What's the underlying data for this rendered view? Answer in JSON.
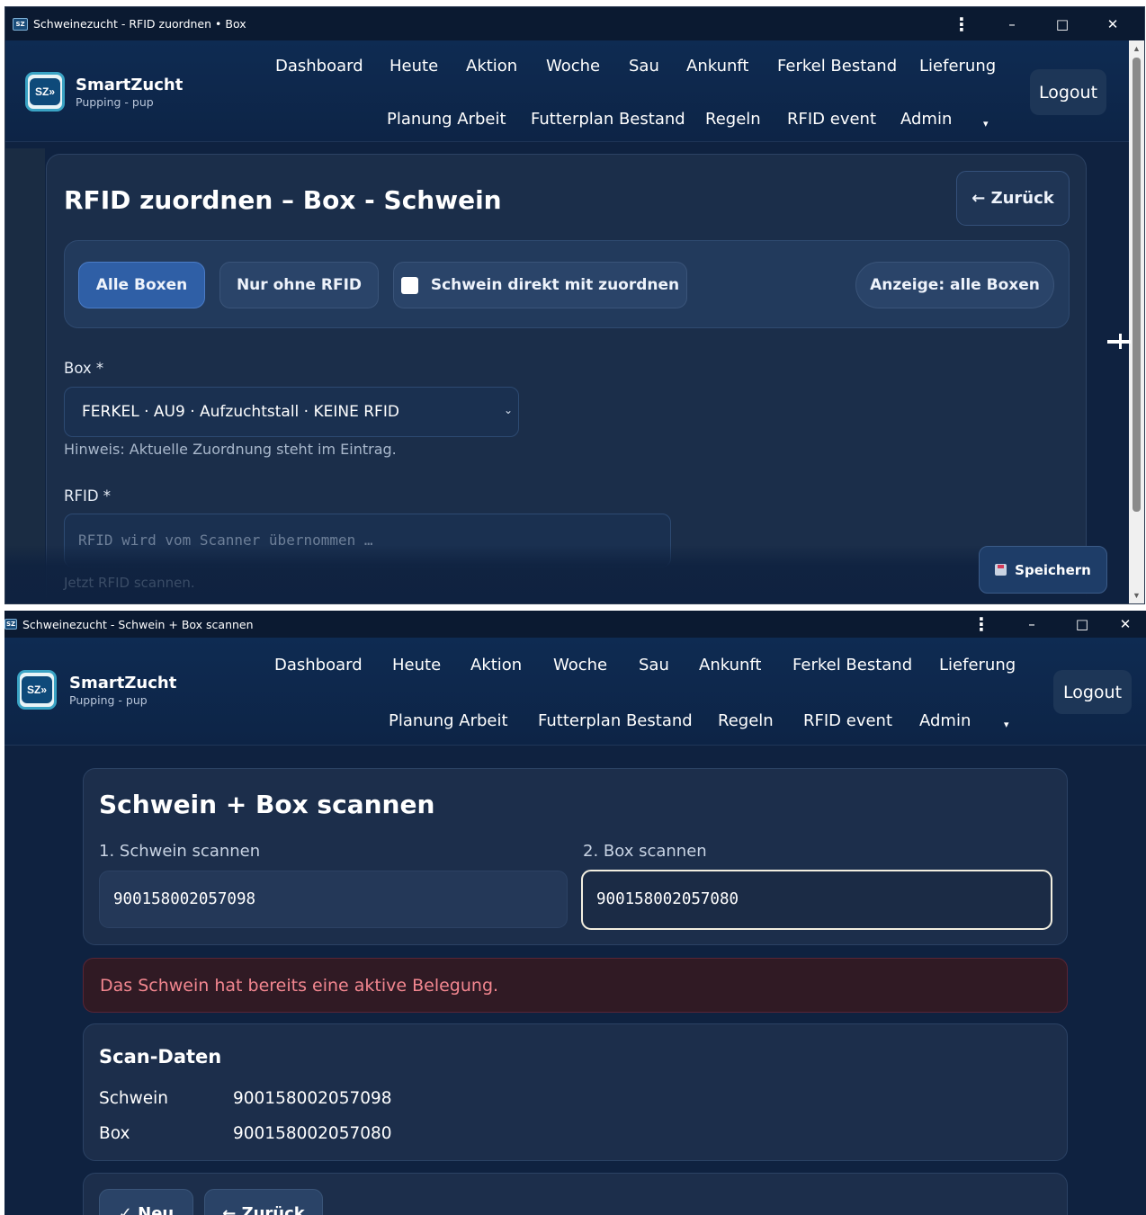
{
  "window1": {
    "title": "Schweinezucht - RFID zuordnen • Box",
    "brand": {
      "name": "SmartZucht",
      "sub": "Pupping - pup",
      "logo_text": "SZ»"
    },
    "nav_row1": [
      "Dashboard",
      "Heute",
      "Aktion",
      "Woche",
      "Sau",
      "Ankunft",
      "Ferkel Bestand",
      "Lieferung"
    ],
    "nav_row2": [
      "Planung Arbeit",
      "Futterplan Bestand",
      "Regeln",
      "RFID event",
      "Admin"
    ],
    "nav_caret": "▾",
    "logout_label": "Logout",
    "heading": "RFID zuordnen – Box - Schwein",
    "back_label": "← Zurück",
    "filters": {
      "all_boxes": "Alle Boxen",
      "without_rfid": "Nur ohne RFID",
      "assign_pig": "Schwein direkt mit zuordnen",
      "display": "Anzeige: alle Boxen"
    },
    "box_label": "Box *",
    "box_selected": "FERKEL · AU9 · Aufzuchtstall · KEINE RFID",
    "box_hint": "Hinweis: Aktuelle Zuordnung steht im Eintrag.",
    "rfid_label": "RFID *",
    "rfid_placeholder": "RFID wird vom Scanner übernommen …",
    "scan_hint": "Jetzt RFID scannen.",
    "save_label": "Speichern"
  },
  "window2": {
    "title": "Schweinezucht - Schwein + Box scannen",
    "brand": {
      "name": "SmartZucht",
      "sub": "Pupping - pup",
      "logo_text": "SZ»"
    },
    "nav_row1": [
      "Dashboard",
      "Heute",
      "Aktion",
      "Woche",
      "Sau",
      "Ankunft",
      "Ferkel Bestand",
      "Lieferung"
    ],
    "nav_row2": [
      "Planung Arbeit",
      "Futterplan Bestand",
      "Regeln",
      "RFID event",
      "Admin"
    ],
    "nav_caret": "▾",
    "logout_label": "Logout",
    "heading": "Schwein + Box scannen",
    "pig_label": "1. Schwein scannen",
    "pig_value": "900158002057098",
    "box_label": "2. Box scannen",
    "box_value": "900158002057080",
    "alert": "Das Schwein hat bereits eine aktive Belegung.",
    "scan_heading": "Scan-Daten",
    "scan_rows": [
      {
        "key": "Schwein",
        "value": "900158002057098"
      },
      {
        "key": "Box",
        "value": "900158002057080"
      }
    ],
    "new_label": "✓ Neu",
    "back_label": "← Zurück"
  },
  "window_controls": {
    "menu": "⋮",
    "minimize": "–",
    "maximize": "□",
    "close": "✕"
  },
  "colors": {
    "background": "#0f2240",
    "card": "#1b2e4a",
    "accent_active": "#2f5fa6",
    "alert_text": "#f2868f",
    "alert_bg": "#301a24"
  }
}
